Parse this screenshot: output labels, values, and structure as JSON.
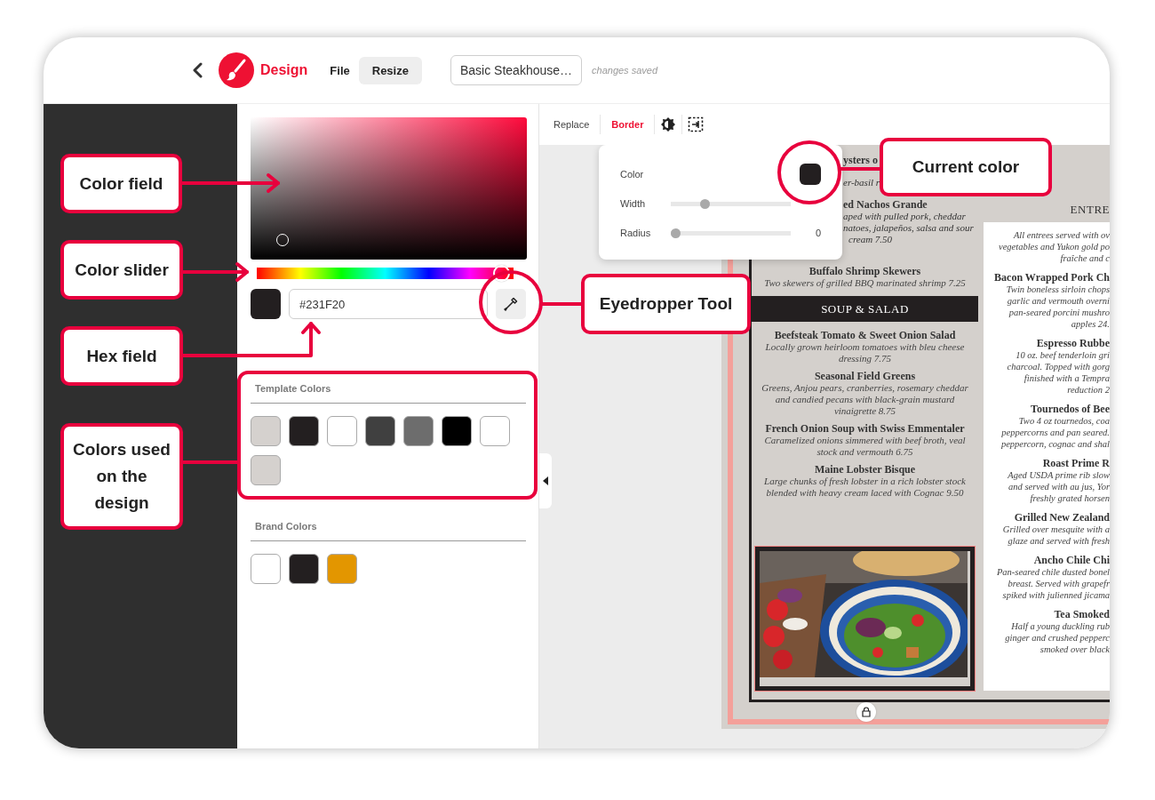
{
  "topbar": {
    "app_name": "Design",
    "menu": [
      {
        "label": "File",
        "selected": false
      },
      {
        "label": "Resize",
        "selected": true
      }
    ],
    "document_title": "Basic Steakhouse…",
    "save_status": "changes saved"
  },
  "color_panel": {
    "color_slider": {
      "level": 0.985
    },
    "current_swatch": {
      "color": "#231f20"
    },
    "hex_value": "#231F20",
    "template_colors": {
      "title": "Template Colors",
      "swatches": [
        {
          "color": "#d5d1ce"
        },
        {
          "color": "#231f20"
        },
        {
          "color": "#ffffff"
        },
        {
          "color": "#404040"
        },
        {
          "color": "#6d6d6d"
        },
        {
          "color": "#000000"
        },
        {
          "color": "#ffffff"
        },
        {
          "color": "#d5d1ce"
        }
      ]
    },
    "brand_colors": {
      "title": "Brand Colors",
      "swatches": [
        {
          "color": "#ffffff"
        },
        {
          "color": "#231f20"
        },
        {
          "color": "#e39600"
        }
      ]
    }
  },
  "toolbar": {
    "tabs": [
      {
        "label": "Replace",
        "selected": false
      },
      {
        "label": "Border",
        "selected": true
      }
    ]
  },
  "border_popup": {
    "color_label": "Color",
    "color": "#231f20",
    "rows": [
      {
        "label": "Width",
        "level": 0.27
      },
      {
        "label": "Radius",
        "level": 0,
        "reading": "0"
      }
    ]
  },
  "menu": {
    "left_fragments": [
      {
        "kind": "name",
        "text": "ysters o"
      },
      {
        "kind": "description",
        "text": "er-basil r"
      },
      {
        "kind": "name",
        "text": "ed Nachos Grande"
      },
      {
        "kind": "description",
        "text": "aped with pulled pork, cheddar"
      },
      {
        "kind": "description",
        "text": "natoes, jalapeños, salsa and sour"
      },
      {
        "kind": "description",
        "text": "cream  7.50"
      }
    ],
    "left_items": [
      {
        "kind": "dish",
        "name": "Buffalo Shrimp Skewers",
        "description": "Two skewers of grilled BBQ marinated shrimp  7.25"
      },
      {
        "kind": "section",
        "name": "SOUP & SALAD"
      },
      {
        "kind": "dish",
        "name": "Beefsteak Tomato & Sweet Onion Salad",
        "description": "Locally grown heirloom tomatoes with bleu cheese dressing  7.75"
      },
      {
        "kind": "dish",
        "name": "Seasonal Field Greens",
        "description": "Greens, Anjou pears, cranberries, rosemary cheddar and candied pecans with black-grain mustard vinaigrette  8.75"
      },
      {
        "kind": "dish",
        "name": "French Onion Soup with Swiss Emmentaler",
        "description": "Caramelized onions simmered with beef broth, veal stock and vermouth  6.75"
      },
      {
        "kind": "dish",
        "name": "Maine Lobster Bisque",
        "description": "Large chunks of fresh lobster in a rich lobster stock blended with heavy cream laced with Cognac  9.50"
      },
      {
        "kind": "picture"
      }
    ],
    "right_items": [
      {
        "kind": "section",
        "name": "ENTRE"
      },
      {
        "kind": "dish",
        "lines": [
          "All entrees served with ov",
          "vegetables and Yukon gold po",
          "fraîche and c"
        ]
      },
      {
        "kind": "dish",
        "name": "Bacon Wrapped Pork Ch",
        "lines": [
          "Twin boneless sirloin chops",
          "garlic and vermouth overni",
          "pan-seared porcini mushro",
          "apples  24."
        ]
      },
      {
        "kind": "dish",
        "name": "Espresso Rubbe",
        "lines": [
          "10 oz. beef tenderloin gri",
          "charcoal. Topped with gorg",
          "finished with a Tempra",
          "reduction  2"
        ]
      },
      {
        "kind": "dish",
        "name": "Tournedos of Bee",
        "lines": [
          "Two 4 oz tournedos, coa",
          "peppercorns and pan seared.",
          "peppercorn, cognac and shal"
        ]
      },
      {
        "kind": "dish",
        "name": "Roast Prime R",
        "lines": [
          "Aged USDA prime rib slow",
          "and served with au jus, Yor",
          "freshly grated horsen"
        ]
      },
      {
        "kind": "dish",
        "name": "Grilled New Zealand",
        "lines": [
          "Grilled over mesquite with a",
          "glaze and served with fresh"
        ]
      },
      {
        "kind": "dish",
        "name": "Ancho Chile Chi",
        "lines": [
          "Pan-seared chile dusted bonel",
          "breast. Served with grapefr",
          "spiked with julienned jicama"
        ]
      },
      {
        "kind": "dish",
        "name": "Tea Smoked",
        "lines": [
          "Half a young duckling rub",
          "ginger and crushed pepperc",
          "smoked over black"
        ]
      }
    ]
  },
  "annotations": [
    {
      "label": "Color field",
      "kind": "arrow"
    },
    {
      "label": "Color slider",
      "kind": "arrow"
    },
    {
      "label": "Hex field",
      "kind": "arrow"
    },
    {
      "label": "Colors used on the design",
      "kind": "frame"
    },
    {
      "label": "Eyedropper Tool",
      "kind": "circle"
    },
    {
      "label": "Current color",
      "kind": "circle"
    }
  ]
}
